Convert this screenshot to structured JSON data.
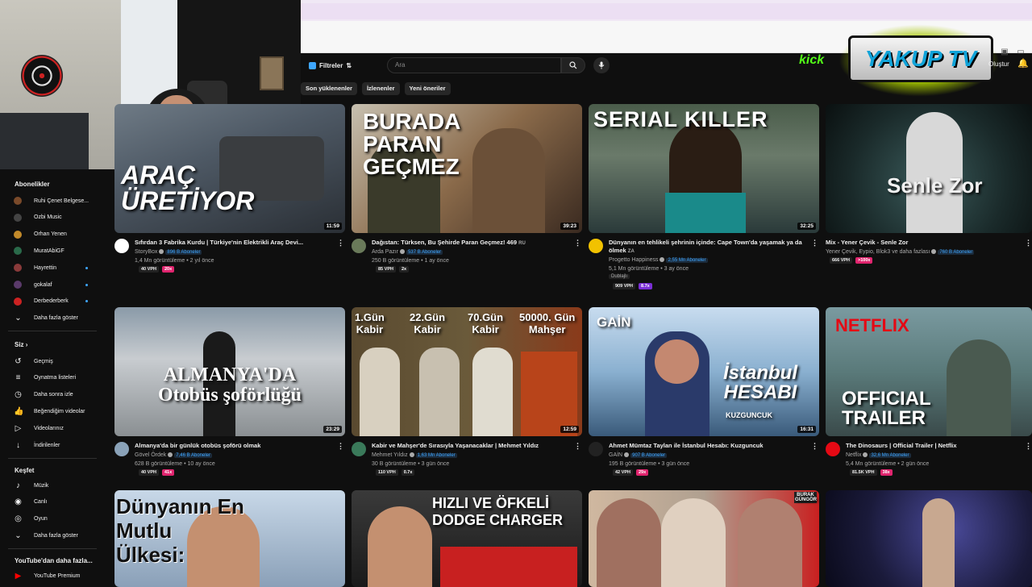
{
  "header": {
    "filters_label": "Filtreler",
    "search_placeholder": "Ara",
    "kick_logo": "kick",
    "overlay_logo": "YAKUP TV",
    "create_label": "Oluştur"
  },
  "webcam": {
    "brand": "logi"
  },
  "chips": [
    "Son yüklenenler",
    "İzlenenler",
    "Yeni öneriler"
  ],
  "sidebar": {
    "subscriptions_title": "Abonelikler",
    "subscriptions": [
      {
        "label": "Ruhi Çenet Belgese...",
        "color": "#7a4a2a",
        "dot": false
      },
      {
        "label": "Ozbi Music",
        "color": "#444444",
        "dot": false
      },
      {
        "label": "Orhan Yenen",
        "color": "#c28a2a",
        "dot": false
      },
      {
        "label": "MuratAbiGF",
        "color": "#2a6a4a",
        "dot": false
      },
      {
        "label": "Hayrettin",
        "color": "#8a3a3a",
        "dot": true
      },
      {
        "label": "gokalaf",
        "color": "#5a3a6a",
        "dot": true
      },
      {
        "label": "Derbederberk",
        "color": "#cc2222",
        "dot": true
      }
    ],
    "subs_more": "Daha fazla göster",
    "you_title": "Siz",
    "you_items": [
      {
        "label": "Geçmiş",
        "icon": "history-icon"
      },
      {
        "label": "Oynatma listeleri",
        "icon": "playlist-icon"
      },
      {
        "label": "Daha sonra izle",
        "icon": "clock-icon"
      },
      {
        "label": "Beğendiğim videolar",
        "icon": "thumb-up-icon"
      },
      {
        "label": "Videolarınız",
        "icon": "video-icon"
      },
      {
        "label": "İndirilenler",
        "icon": "download-icon"
      }
    ],
    "explore_title": "Keşfet",
    "explore_items": [
      {
        "label": "Müzik",
        "icon": "music-icon"
      },
      {
        "label": "Canlı",
        "icon": "live-icon"
      },
      {
        "label": "Oyun",
        "icon": "game-icon"
      }
    ],
    "explore_more": "Daha fazla göster",
    "more_title": "YouTube'dan daha fazla...",
    "premium": "YouTube Premium"
  },
  "videos": [
    {
      "title": "Sıfırdan 3 Fabrika Kurdu | Türkiye'nin Elektrikli Araç Devi...",
      "channel": "StoryBox",
      "subs": "896 B Aboneler",
      "views": "1,4 Mn görüntüleme",
      "age": "2 yıl önce",
      "duration": "11:59",
      "vph": "40 VPH",
      "mult": "20x",
      "mult_color": "#e0246e",
      "av_color": "#ffffff",
      "thumb_text": "ARAÇ\nÜRETİYOR"
    },
    {
      "title": "Dağıstan: Türksen, Bu Şehirde Paran Geçmez! 469",
      "title_badge": "RU",
      "channel": "Arda Pazır",
      "subs": "537 B Aboneler",
      "views": "250 B görüntüleme",
      "age": "1 ay önce",
      "duration": "39:23",
      "vph": "85 VPH",
      "mult": "2x",
      "mult_color": "#222222",
      "av_color": "#6a7a5a",
      "thumb_text": "BURADA\nPARAN\nGEÇMEZ"
    },
    {
      "title": "Dünyanın en tehlikeli şehrinin içinde: Cape Town'da yaşamak ya da ölmek",
      "title_badge": "ZA",
      "channel": "Progetto Happiness",
      "subs": "2,55 Mn Aboneler",
      "views": "5,1 Mn görüntüleme",
      "age": "3 ay önce",
      "duration": "32:25",
      "vph": "909 VPH",
      "mult": "8.7x",
      "mult_color": "#7b2fd6",
      "av_color": "#f2c200",
      "dubbed": "Dublajlı",
      "thumb_text": "SERIAL KILLER"
    },
    {
      "title": "Mix - Yener Çevik - Senle Zor",
      "channel": "Yener Çevik, Eypio, Blok3 ve daha fazlası",
      "subs": "760 B Aboneler",
      "vph": "666 VPH",
      "mult": ">100x",
      "mult_color": "#e0246e",
      "thumb_text": "Senle Zor"
    },
    {
      "title": "Almanya'da bir günlük otobüs şoförü olmak",
      "channel": "Gövel Ördek",
      "subs": "7,46 B Aboneler",
      "views": "628 B görüntüleme",
      "age": "10 ay önce",
      "duration": "23:29",
      "vph": "40 VPH",
      "mult": "41x",
      "mult_color": "#e0246e",
      "av_color": "#8aa2b8",
      "thumb_text": "ALMANYA'DA\nOtobüs şoförlüğü"
    },
    {
      "title": "Kabir ve Mahşer'de Sırasıyla Yaşanacaklar | Mehmet Yıldız",
      "channel": "Mehmet Yıldız",
      "subs": "1,63 Mn Aboneler",
      "views": "30 B görüntüleme",
      "age": "3 gün önce",
      "duration": "12:59",
      "vph": "110 VPH",
      "mult": "0.7x",
      "mult_color": "#222222",
      "av_color": "#3a7a5a",
      "thumb_labels": [
        "1.Gün\nKabir",
        "22.Gün\nKabir",
        "70.Gün\nKabir",
        "50000. Gün\nMahşer"
      ]
    },
    {
      "title": "Ahmet Mümtaz Taylan ile İstanbul Hesabı: Kuzguncuk",
      "channel": "GAİN",
      "subs": "907 B Aboneler",
      "views": "195 B görüntüleme",
      "age": "3 gün önce",
      "duration": "16:31",
      "vph": "42 VPH",
      "mult": "29x",
      "mult_color": "#e0246e",
      "av_color": "#222222",
      "thumb_brand": "GAİN",
      "thumb_text": "İstanbul\nHESABI",
      "thumb_sub": "KUZGUNCUK"
    },
    {
      "title": "The Dinosaurs | Official Trailer | Netflix",
      "channel": "Netflix",
      "subs": "32,6 Mn Aboneler",
      "views": "5,4 Mn görüntüleme",
      "age": "2 gün önce",
      "vph": "81.5K VPH",
      "mult": "38x",
      "mult_color": "#e0246e",
      "av_color": "#e50914",
      "thumb_brand": "NETFLIX",
      "thumb_text": "OFFICIAL\nTRAILER"
    }
  ],
  "row3": [
    {
      "thumb_text": "Dünyanın En\nMutlu\nÜlkesi:"
    },
    {
      "thumb_text": "HIZLI VE ÖFKELİ\nDODGE CHARGER"
    },
    {
      "thumb_brand": "BURAK GÜNGÖR"
    },
    {}
  ]
}
